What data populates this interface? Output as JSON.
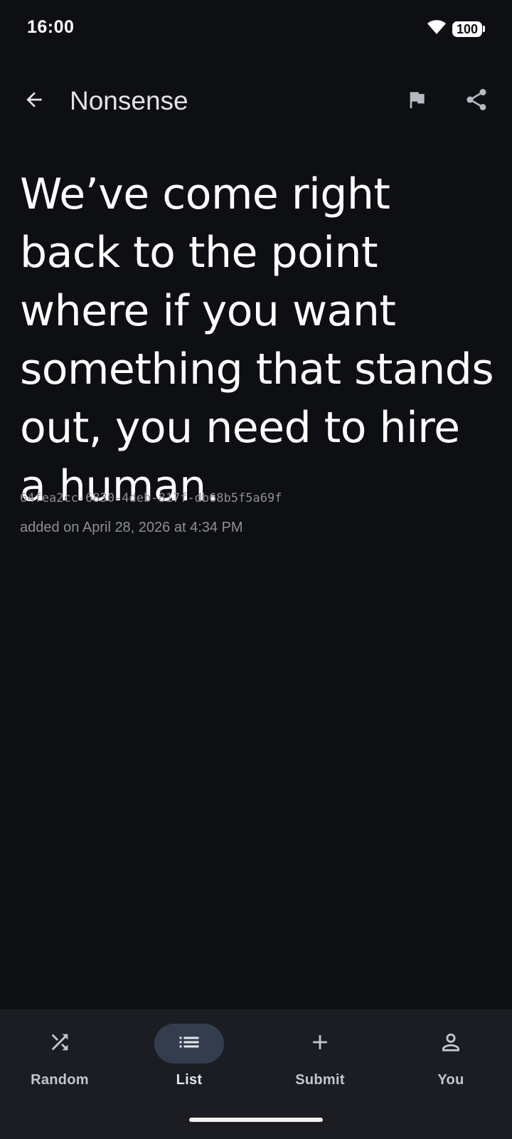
{
  "status_bar": {
    "time": "16:00",
    "battery": "100",
    "wifi_icon": "wifi-icon"
  },
  "app_bar": {
    "title": "Nonsense",
    "back_icon": "arrow-back-icon",
    "flag_icon": "flag-icon",
    "share_icon": "share-icon"
  },
  "quote": {
    "text": "We’ve come right back to the point where if you want something that stands out, you need to hire a human.",
    "id": "64fea2cc-6830-4deb-817f-db68b5f5a69f",
    "added": "added on April 28, 2026 at 4:34 PM"
  },
  "bottom_nav": {
    "items": [
      {
        "label": "Random",
        "icon": "shuffle-icon",
        "active": false
      },
      {
        "label": "List",
        "icon": "list-icon",
        "active": true
      },
      {
        "label": "Submit",
        "icon": "plus-icon",
        "active": false
      },
      {
        "label": "You",
        "icon": "person-icon",
        "active": false
      }
    ]
  },
  "colors": {
    "background": "#0e0f13",
    "nav_background": "#1b1d22",
    "active_pill": "#343d4d",
    "text_primary": "#ffffff",
    "text_secondary": "#8e8f96"
  }
}
